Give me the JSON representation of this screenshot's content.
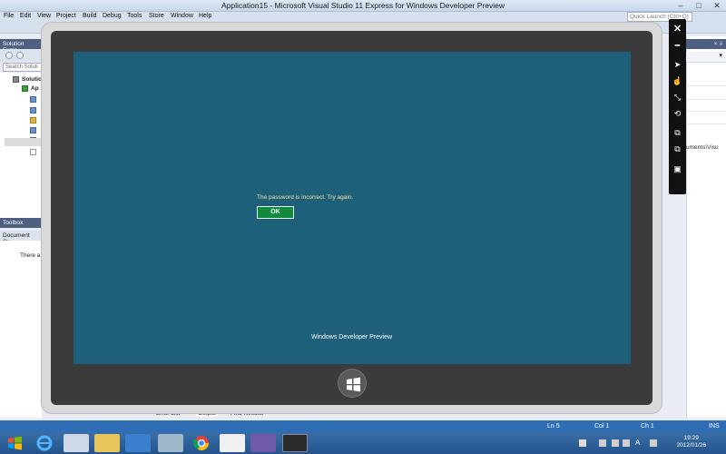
{
  "window": {
    "title": "Application15 - Microsoft Visual Studio 11 Express for Windows Developer Preview",
    "quick_launch_placeholder": "Quick Launch (Ctrl+Q)",
    "controls": {
      "minimize": "–",
      "maximize": "□",
      "close": "✕"
    }
  },
  "menu": [
    "File",
    "Edit",
    "View",
    "Project",
    "Build",
    "Debug",
    "Tools",
    "Store",
    "Window",
    "Help"
  ],
  "solution_explorer": {
    "header": "Solution Explo",
    "search_placeholder": "Search Soluti",
    "tree": [
      {
        "label": "Solutio",
        "icon": "solution-icon"
      },
      {
        "label": "Ap",
        "icon": "project-icon"
      }
    ]
  },
  "toolbox": {
    "tab_label": "Toolbox"
  },
  "document_outline": {
    "header": "Document Ou",
    "text": "There a"
  },
  "right_panel": {
    "header_text": "× ⇩",
    "strip_glyph": "▾",
    "path_text": "uments\\Visu"
  },
  "bottom_tabs": [
    "Error List",
    "Output",
    "Find Results"
  ],
  "status": {
    "ln": "Ln 5",
    "col": "Col 1",
    "ch": "Ch 1",
    "mode": "INS"
  },
  "simulator": {
    "dialog_message": "The password is incorrect. Try again.",
    "ok_label": "OK",
    "footer": "Windows Developer Preview",
    "toolbar": [
      "close-icon",
      "minimize-icon",
      "pointer-icon",
      "touch-icon",
      "pinch-zoom-icon",
      "rotate-icon",
      "rotate-clockwise-icon",
      "rotate-counterclockwise-icon",
      "resolution-icon"
    ]
  },
  "taskbar": {
    "apps": [
      "ie-icon",
      "network-icon",
      "explorer-icon",
      "tablet-icon",
      "media-icon",
      "chrome-icon",
      "paint-icon",
      "vs-icon",
      "simulator-icon"
    ],
    "clock_time": "19:29",
    "clock_date": "2012/01/26",
    "ime": "A"
  }
}
